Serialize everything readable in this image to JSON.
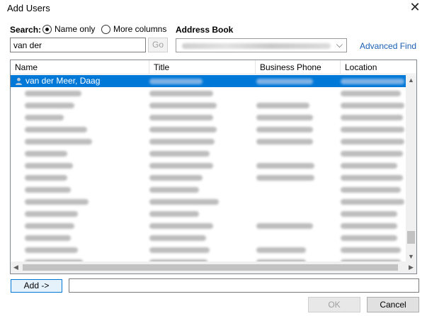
{
  "window": {
    "title": "Add Users",
    "close_glyph": "✕"
  },
  "search": {
    "label": "Search:",
    "options": [
      {
        "label": "Name only",
        "selected": true
      },
      {
        "label": "More columns",
        "selected": false
      }
    ],
    "query": "van der",
    "go_label": "Go"
  },
  "address_book": {
    "label": "Address Book",
    "chevron": "⌵"
  },
  "advanced_find": "Advanced Find",
  "table": {
    "columns": [
      "Name",
      "Title",
      "Business Phone",
      "Location"
    ],
    "selected_row": {
      "name": "van der Meer, Daag"
    }
  },
  "scroll": {
    "up": "▲",
    "down": "▼",
    "left": "◀",
    "right": "▶"
  },
  "footer": {
    "add_label": "Add ->",
    "ok_label": "OK",
    "cancel_label": "Cancel"
  },
  "colors": {
    "selection": "#0078d7",
    "link": "#1a5fb4"
  }
}
